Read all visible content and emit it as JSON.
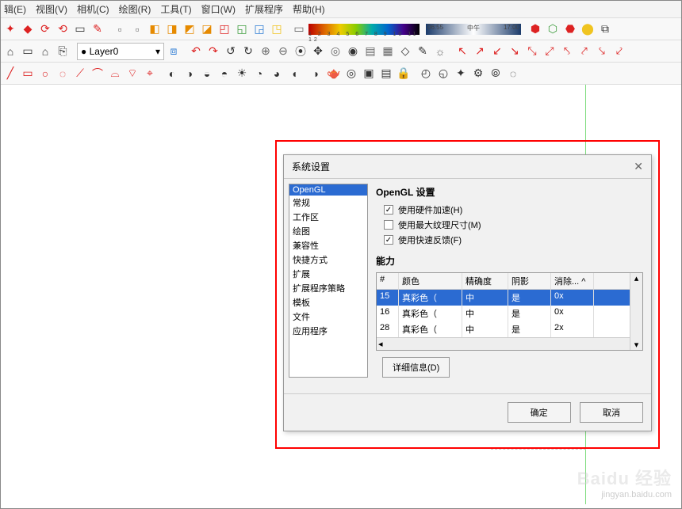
{
  "menu": [
    "辑(E)",
    "视图(V)",
    "相机(C)",
    "绘图(R)",
    "工具(T)",
    "窗口(W)",
    "扩展程序",
    "帮助(H)"
  ],
  "layer": {
    "label": "Layer0"
  },
  "gradient_labels": "1 2 3 4 5 6 7 8 9 10 11 12",
  "time_labels": {
    "left": "06:55",
    "mid": "中午",
    "right": "17:00"
  },
  "dialog": {
    "title": "系统设置",
    "sidebar": [
      "OpenGL",
      "常规",
      "工作区",
      "绘图",
      "兼容性",
      "快捷方式",
      "扩展",
      "扩展程序策略",
      "模板",
      "文件",
      "应用程序"
    ],
    "selected_idx": 0,
    "section_title": "OpenGL 设置",
    "checks": [
      {
        "checked": true,
        "label": "使用硬件加速(H)"
      },
      {
        "checked": false,
        "label": "使用最大纹理尺寸(M)"
      },
      {
        "checked": true,
        "label": "使用快速反馈(F)"
      }
    ],
    "cap_title": "能力",
    "table": {
      "headers": [
        "#",
        "颜色",
        "精确度",
        "阴影",
        "消除... ^"
      ],
      "rows": [
        {
          "n": "15",
          "c": "真彩色（",
          "p": "中",
          "s": "是",
          "x": "0x",
          "sel": true
        },
        {
          "n": "16",
          "c": "真彩色（",
          "p": "中",
          "s": "是",
          "x": "0x",
          "sel": false
        },
        {
          "n": "28",
          "c": "真彩色（",
          "p": "中",
          "s": "是",
          "x": "2x",
          "sel": false
        }
      ]
    },
    "detail_btn": "详细信息(D)",
    "ok": "确定",
    "cancel": "取消"
  },
  "watermark": {
    "brand": "Baidu 经验",
    "sub": "jingyan.baidu.com"
  }
}
